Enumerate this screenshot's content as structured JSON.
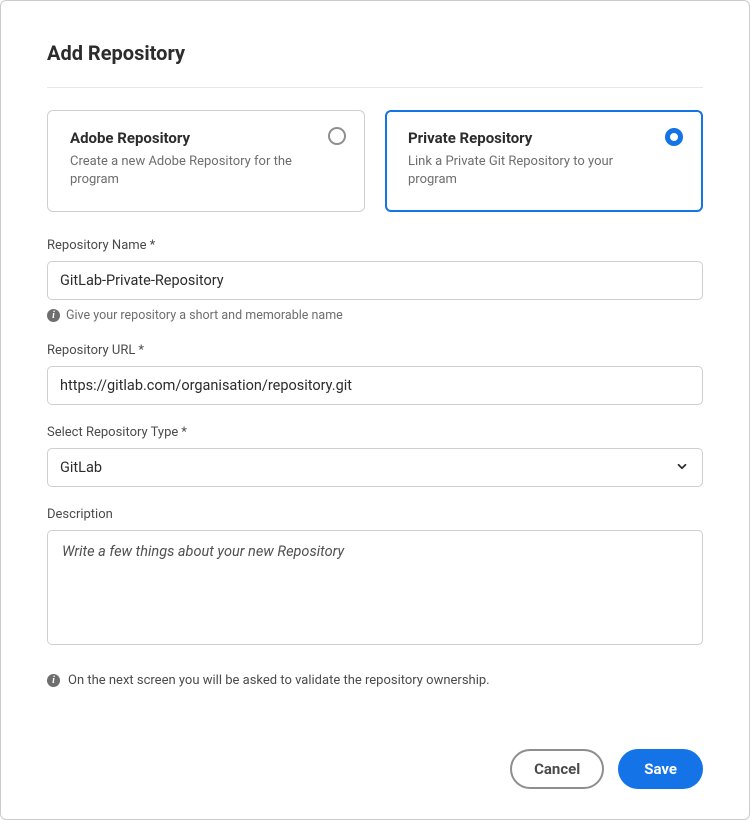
{
  "dialog": {
    "title": "Add Repository"
  },
  "repoTypes": {
    "adobe": {
      "title": "Adobe Repository",
      "desc": "Create a new Adobe Repository for the program"
    },
    "private": {
      "title": "Private Repository",
      "desc": "Link a Private Git Repository to your program"
    }
  },
  "fields": {
    "name": {
      "label": "Repository Name",
      "required": "*",
      "value": "GitLab-Private-Repository",
      "helper": "Give your repository a short and memorable name"
    },
    "url": {
      "label": "Repository URL",
      "required": "*",
      "value": "https://gitlab.com/organisation/repository.git"
    },
    "type": {
      "label": "Select Repository Type",
      "required": "*",
      "value": "GitLab"
    },
    "description": {
      "label": "Description",
      "placeholder": "Write a few things about your new Repository"
    }
  },
  "footer": {
    "note": "On the next screen you will be asked to validate the repository ownership."
  },
  "actions": {
    "cancel": "Cancel",
    "save": "Save"
  }
}
